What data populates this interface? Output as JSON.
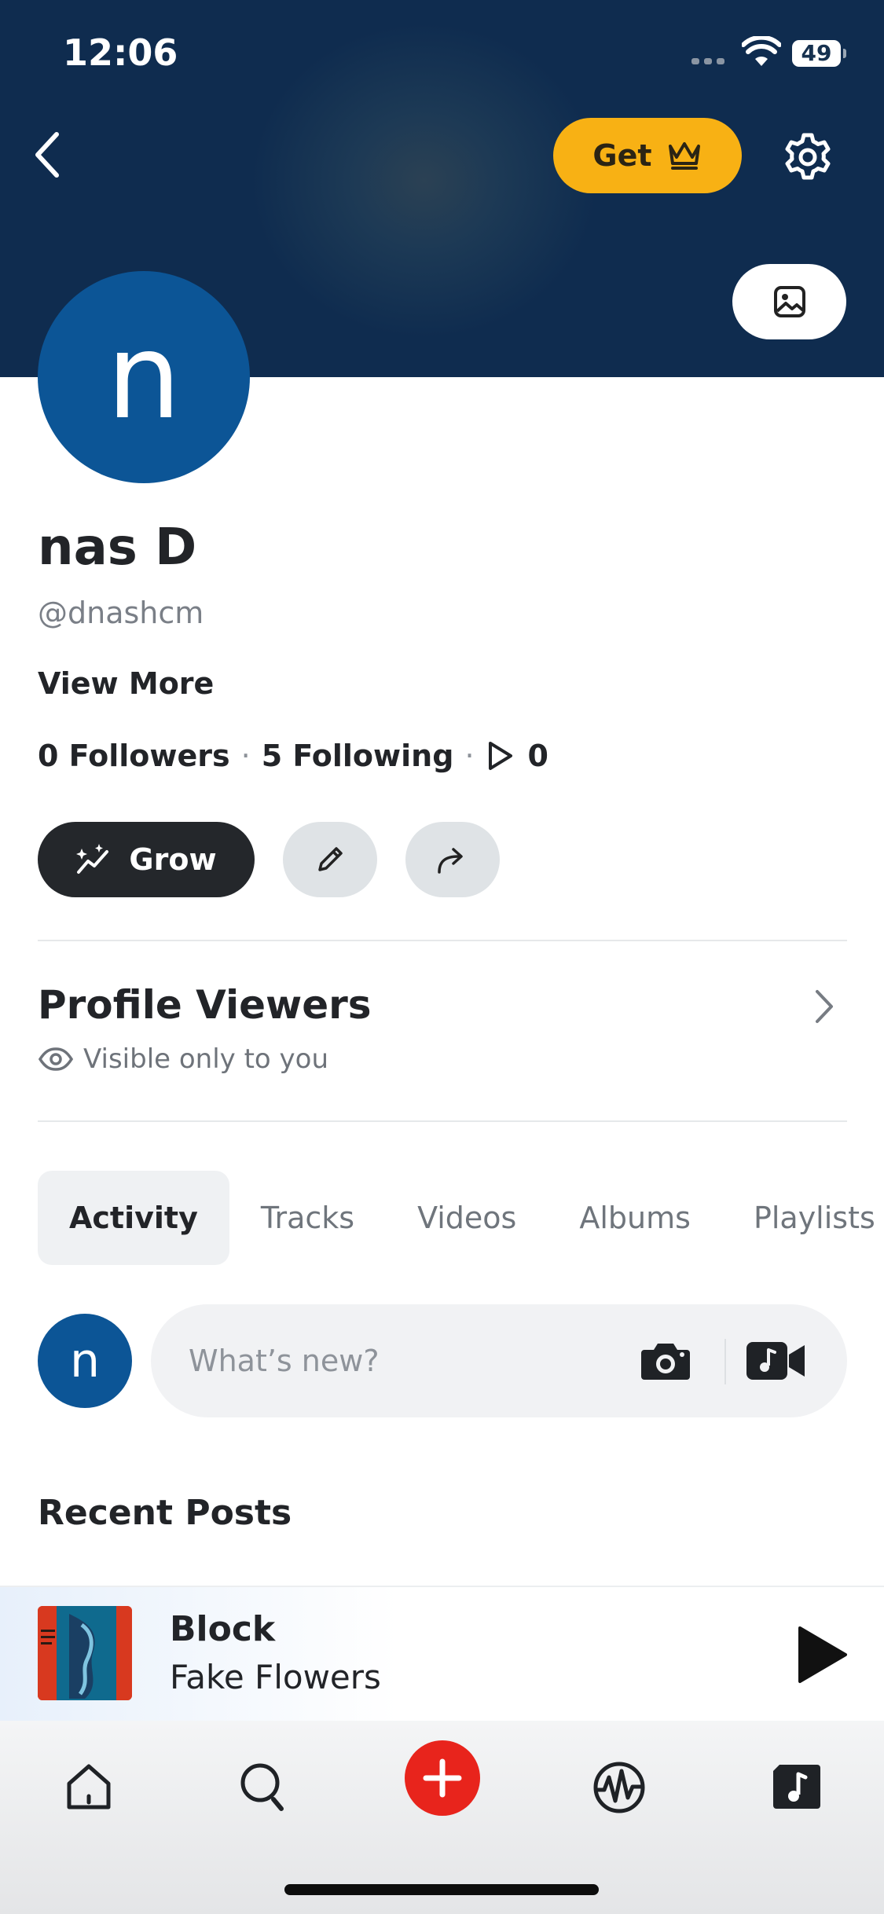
{
  "status_bar": {
    "time": "12:06",
    "battery": "49"
  },
  "header": {
    "get_label": "Get"
  },
  "profile": {
    "avatar_letter": "n",
    "name": "nas D",
    "handle": "@dnashcm",
    "view_more": "View More",
    "followers": "0 Followers",
    "following": "5 Following",
    "plays": "0",
    "grow_label": "Grow"
  },
  "profile_viewers": {
    "title": "Profile Viewers",
    "subtitle": "Visible only to you"
  },
  "tabs": [
    {
      "label": "Activity",
      "active": true
    },
    {
      "label": "Tracks",
      "active": false
    },
    {
      "label": "Videos",
      "active": false
    },
    {
      "label": "Albums",
      "active": false
    },
    {
      "label": "Playlists",
      "active": false
    }
  ],
  "composer": {
    "avatar_letter": "n",
    "placeholder": "What’s new?"
  },
  "recent_posts": {
    "title": "Recent Posts"
  },
  "now_playing": {
    "title": "Block",
    "artist": "Fake Flowers"
  },
  "colors": {
    "accent_red": "#e8241c",
    "get_yellow": "#f8b114",
    "avatar_blue": "#0c5596",
    "banner_navy": "#0f2c4f"
  },
  "tabbar": {
    "items": [
      {
        "icon": "home-icon"
      },
      {
        "icon": "search-icon"
      },
      {
        "icon": "plus-icon"
      },
      {
        "icon": "waveform-icon"
      },
      {
        "icon": "library-music-icon"
      }
    ]
  }
}
